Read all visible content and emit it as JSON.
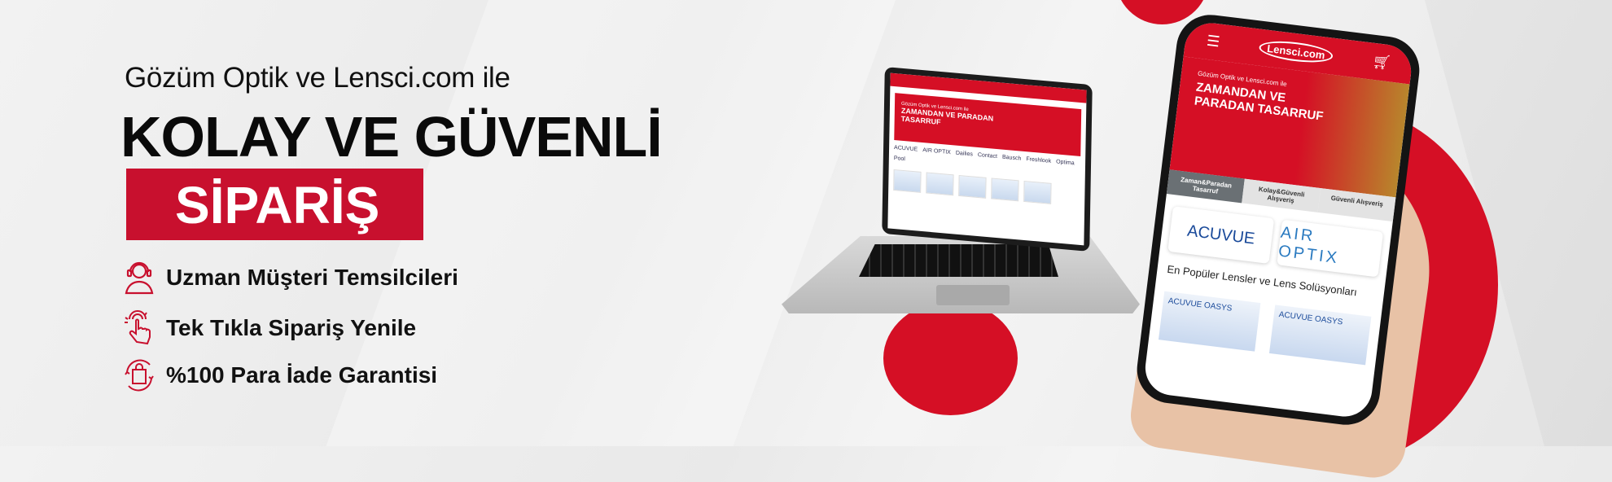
{
  "hero": {
    "subtitle": "Gözüm Optik ve Lensci.com ile",
    "headline": "KOLAY VE GÜVENLİ",
    "badge": "SİPARİŞ"
  },
  "features": [
    {
      "icon": "headset-user-icon",
      "label": "Uzman Müşteri Temsilcileri"
    },
    {
      "icon": "tap-hand-icon",
      "label": "Tek Tıkla Sipariş Yenile"
    },
    {
      "icon": "refund-bag-icon",
      "label": "%100 Para İade Garantisi"
    }
  ],
  "laptop_screen": {
    "hero_small": "Gözüm Optik ve Lensci.com ile",
    "hero_title": "ZAMANDAN VE PARADAN TASARRUF",
    "brands": [
      "ACUVUE",
      "AIR OPTIX",
      "Dailies",
      "Contact",
      "Bausch",
      "Freshlook",
      "Optima",
      "Pool"
    ]
  },
  "phone_screen": {
    "logo": "Lensci.com",
    "hero_small": "Gözüm Optik ve Lensci.com ile",
    "hero_title": "ZAMANDAN VE PARADAN TASARRUF",
    "tabs": [
      "Zaman&Paradan Tasarruf",
      "Kolay&Güvenli Alışveriş",
      "Güvenli Alışveriş"
    ],
    "brands": [
      "ACUVUE",
      "AIR OPTIX"
    ],
    "section_title": "En Popüler Lensler ve Lens Solüsyonları",
    "products": [
      "ACUVUE OASYS",
      "ACUVUE OASYS"
    ]
  },
  "colors": {
    "accent": "#c8102e",
    "text": "#111111"
  }
}
